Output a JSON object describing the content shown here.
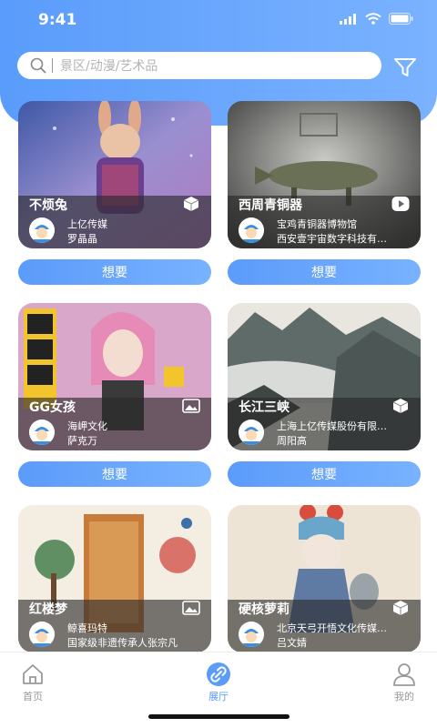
{
  "status": {
    "time": "9:41"
  },
  "search": {
    "placeholder": "景区/动漫/艺术品"
  },
  "cards": [
    {
      "title": "不烦兔",
      "line1": "上亿传媒",
      "line2": "罗晶晶",
      "type_icon": "3d-cube-icon",
      "button": "想要"
    },
    {
      "title": "西周青铜器",
      "line1": "宝鸡青铜器博物馆",
      "line2": "西安壹宇宙数字科技有…",
      "type_icon": "video-play-icon",
      "button": "想要"
    },
    {
      "title": "GG女孩",
      "line1": "海岬文化",
      "line2": "萨克万",
      "type_icon": "image-icon",
      "button": "想要"
    },
    {
      "title": "长江三峡",
      "line1": "上海上亿传媒股份有限…",
      "line2": "周阳高",
      "type_icon": "3d-cube-icon",
      "button": "想要"
    },
    {
      "title": "红楼梦",
      "line1": "鲸喜玛特",
      "line2": "国家级非遗传承人张宗凡",
      "type_icon": "image-icon",
      "button": "想要"
    },
    {
      "title": "硬核萝莉",
      "line1": "北京天弓开悟文化传媒…",
      "line2": "吕文婧",
      "type_icon": "3d-cube-icon",
      "button": "想要"
    }
  ],
  "tabs": [
    {
      "label": "首页",
      "icon": "home-icon",
      "active": false
    },
    {
      "label": "展厅",
      "icon": "link-icon",
      "active": true
    },
    {
      "label": "我的",
      "icon": "user-icon",
      "active": false
    }
  ],
  "colors": {
    "accent": "#5b9bfa",
    "header": "#6aa8ff"
  }
}
